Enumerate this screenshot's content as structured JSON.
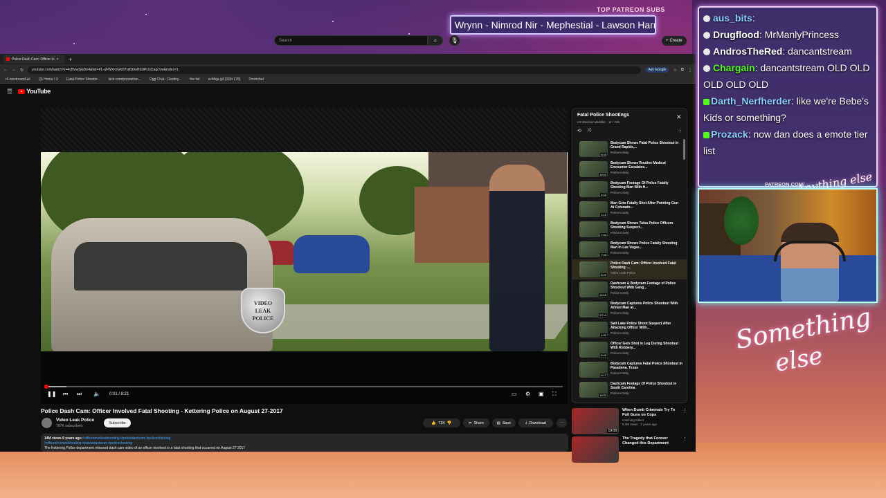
{
  "overlay": {
    "patreon_heading": "TOP PATREON SUBS",
    "patreon_names": "Wrynn - Nimrod Nir - Mephestial - Lawson Harr",
    "patreon_url": "PATREON.COM/",
    "signature_top": "Anything else",
    "signature_bottom_1": "Something",
    "signature_bottom_2": "else"
  },
  "browser": {
    "tab_title": "Police Dash Cam: Officer In",
    "new_tab": "+",
    "url": "youtube.com/watch?v=4vBVw3yEBz4&list=PL-aFWXKXyKBTqfObGH62iPLtxDagcVw&index=1",
    "ask_google": "Ask Google",
    "bookmarks": [
      "r/LivestreamFail",
      "(3) Home / X",
      "Fatal Police Shootin...",
      "kick.com/popout/an...",
      "Ogg Chat - Destiny...",
      "the list",
      "evMsja.gif (399×278)",
      "Omnichat"
    ]
  },
  "youtube": {
    "logo": "YouTube",
    "search_placeholder": "Search",
    "create": "Create",
    "time": "0:01 / 8:21",
    "badge": [
      "VIDEO",
      "LEAK",
      "POLICE"
    ],
    "video_title": "Police Dash Cam: Officer Involved Fatal Shooting - Kettering Police on August 27-2017",
    "channel": "Video Leak Police",
    "subscribers": "787K subscribers",
    "subscribe": "Subscribe",
    "likes": "71K",
    "share": "Share",
    "save": "Save",
    "download": "Download",
    "desc_views": "14M views  8 years ago",
    "desc_tags1": "#officerinvolvedshooting #policedashcam #policeshooting",
    "desc_tags2": "#officerinvolvedshooting #policedashcam #policeshooting",
    "desc_text": "The Kettering Police department released dash cam video of an officer involved in a fatal shooting that occurred on August 27 2017"
  },
  "playlist": {
    "title": "Fatal Police Shootings",
    "subtitle": "US Election Meddler · 11 / 196",
    "items": [
      {
        "title": "Bodycam Shows Fatal Police Shootout In Grand Rapids,...",
        "channel": "PoliceActivity",
        "dur": "6:43"
      },
      {
        "title": "Bodycam Shows Routine Medical Encounter Escalates...",
        "channel": "PoliceActivity",
        "dur": "10:53"
      },
      {
        "title": "Bodycam Footage Of Police Fatally Shooting Man With H...",
        "channel": "PoliceActivity",
        "dur": "4:22"
      },
      {
        "title": "Man Gets Fatally Shot After Pointing Gun At Colorado...",
        "channel": "PoliceActivity",
        "dur": "1:12"
      },
      {
        "title": "Bodycam Shows Tulsa Police Officers Shooting Suspect...",
        "channel": "PoliceActivity",
        "dur": "7:44"
      },
      {
        "title": "Bodycam Shows Police Fatally Shooting Man In Las Vegas...",
        "channel": "PoliceActivity",
        "dur": "7:49"
      },
      {
        "title": "Police Dash Cam: Officer Involved Fatal Shooting -...",
        "channel": "Video Leak Police",
        "dur": "8:22"
      },
      {
        "title": "Dashcam & Bodycam Footage of Police Shootout With Gang...",
        "channel": "PoliceActivity",
        "dur": "10:10"
      },
      {
        "title": "Bodycam Captures Police Shootout With Armed Man at...",
        "channel": "PoliceActivity",
        "dur": "17:14"
      },
      {
        "title": "Salt Lake Police Shoot Suspect After Attacking Officer With...",
        "channel": "PoliceActivity",
        "dur": "4:51"
      },
      {
        "title": "Officer Gets Shot in Leg During Shootout With Robbery...",
        "channel": "PoliceActivity",
        "dur": "6:42"
      },
      {
        "title": "Bodycam Captures Fatal Police Shootout in Pasadena, Texas",
        "channel": "PoliceActivity",
        "dur": "5:17"
      },
      {
        "title": "Dashcam Footage Of Police Shootout in South Carolina",
        "channel": "PoliceActivity",
        "dur": "10:53"
      }
    ],
    "active_index": 6
  },
  "recommended": [
    {
      "title": "When Dumb Criminals Try To Pull Guns on Cops",
      "channel": "Catching Killers",
      "meta": "5.3M views · 2 years ago",
      "dur": "19:08"
    },
    {
      "title": "The Tragedy that Forever Changed this Department",
      "channel": "",
      "meta": "",
      "dur": ""
    }
  ],
  "chat": [
    {
      "user": "aus_bits",
      "text": ":",
      "color": "#8ad0ff"
    },
    {
      "user": "Drugflood",
      "text": ": MrManlyPrincess",
      "color": "#ffffff"
    },
    {
      "user": "AndrosTheRed",
      "text": ":  dancantstream",
      "color": "#ffffff"
    },
    {
      "user": "Chargain",
      "text": ": dancantstream OLD OLD OLD OLD OLD",
      "color": "#53fc18"
    },
    {
      "user": "Darth_Nerfherder",
      "text": ": like we're Bebe's Kids or something?",
      "color": "#8ad0ff"
    },
    {
      "user": "Prozack",
      "text": ": now dan does a emote tier list",
      "color": "#8ad0ff"
    }
  ]
}
